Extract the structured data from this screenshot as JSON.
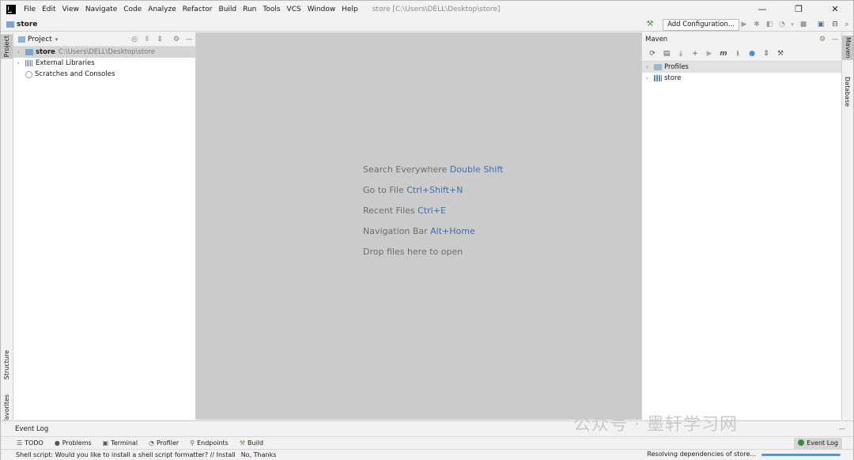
{
  "menubar": {
    "items": [
      "File",
      "Edit",
      "View",
      "Navigate",
      "Code",
      "Analyze",
      "Refactor",
      "Build",
      "Run",
      "Tools",
      "VCS",
      "Window",
      "Help"
    ],
    "window_title": "store [C:\\Users\\DELL\\Desktop\\store]",
    "minimize": "—",
    "restore": "❐",
    "close": "✕"
  },
  "navbar": {
    "crumb": "store",
    "run_config": "Add Configuration..."
  },
  "left_stripe": {
    "project_tab": "Project",
    "structure_tab": "Structure",
    "favorites_tab": "Favorites"
  },
  "project": {
    "title": "Project",
    "tree": [
      {
        "label": "store",
        "path": "C:\\Users\\DELL\\Desktop\\store"
      },
      {
        "label": "External Libraries"
      },
      {
        "label": "Scratches and Consoles"
      }
    ]
  },
  "editor": {
    "hints": [
      {
        "text": "Search Everywhere",
        "key": "Double Shift"
      },
      {
        "text": "Go to File",
        "key": "Ctrl+Shift+N"
      },
      {
        "text": "Recent Files",
        "key": "Ctrl+E"
      },
      {
        "text": "Navigation Bar",
        "key": "Alt+Home"
      },
      {
        "text": "Drop files here to open",
        "key": ""
      }
    ]
  },
  "maven": {
    "title": "Maven",
    "tree": [
      {
        "label": "Profiles"
      },
      {
        "label": "store"
      }
    ]
  },
  "right_stripe": {
    "maven_tab": "Maven",
    "database_tab": "Database"
  },
  "event_log": {
    "title": "Event Log"
  },
  "tool_windows": [
    "TODO",
    "Problems",
    "Terminal",
    "Profiler",
    "Endpoints",
    "Build"
  ],
  "event_log_button": "Event Log",
  "status": {
    "message": "Shell script: Would you like to install a shell script formatter? // Install",
    "no_thanks": "No, Thanks",
    "right": "Resolving dependencies of store...",
    "progress": 1.0
  },
  "watermark": "公众号 · 墨轩学习网",
  "colors": {
    "accent": "#3d70b0",
    "editor_bg": "#cbcbcb",
    "panel_bg": "#f2f2f2"
  }
}
